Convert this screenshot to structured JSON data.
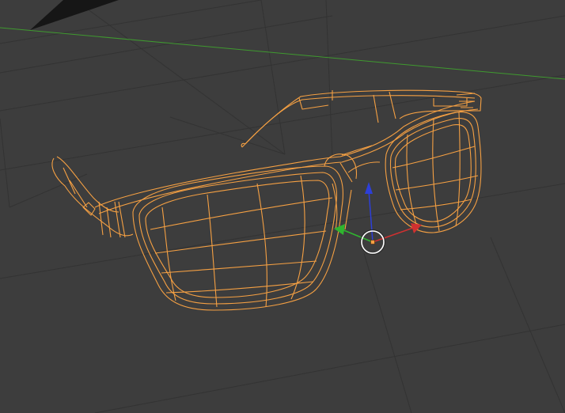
{
  "viewport": {
    "background": "#3d3d3d",
    "grid_color": "#333333",
    "x_axis_color": "#3f9a2f",
    "selection_color": "#f5a043"
  },
  "scene": {
    "object": "glasses-wireframe",
    "mode": "wireframe",
    "selected": true
  },
  "gizmo": {
    "x_axis_color": "#d03030",
    "y_axis_color": "#2fb52f",
    "z_axis_color": "#2d3fd8",
    "cursor_color": "#ffffff"
  }
}
